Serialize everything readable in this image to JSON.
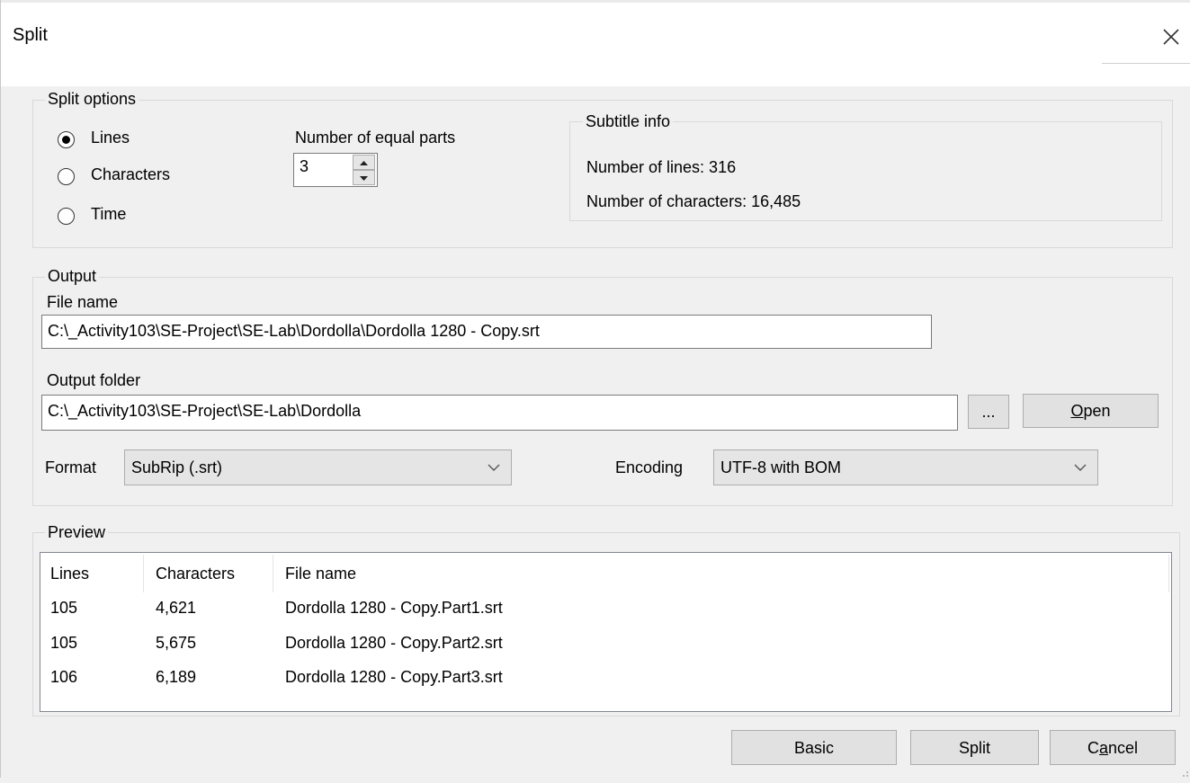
{
  "window": {
    "title": "Split",
    "close_icon": "close-icon"
  },
  "split_options": {
    "label": "Split options",
    "radios": [
      {
        "label": "Lines",
        "checked": true
      },
      {
        "label": "Characters",
        "checked": false
      },
      {
        "label": "Time",
        "checked": false
      }
    ],
    "parts_label": "Number of equal parts",
    "parts_value": "3"
  },
  "subtitle_info": {
    "label": "Subtitle info",
    "lines_text": "Number of lines: 316",
    "chars_text": "Number of characters: 16,485"
  },
  "output": {
    "label": "Output",
    "file_name_label": "File name",
    "file_name_value": "C:\\_Activity103\\SE-Project\\SE-Lab\\Dordolla\\Dordolla 1280 - Copy.srt",
    "folder_label": "Output folder",
    "folder_value": "C:\\_Activity103\\SE-Project\\SE-Lab\\Dordolla",
    "browse_label": "...",
    "open_label_access": "O",
    "open_label_rest": "pen",
    "format_label": "Format",
    "format_value": "SubRip (.srt)",
    "encoding_label": "Encoding",
    "encoding_value": "UTF-8 with BOM"
  },
  "preview": {
    "label": "Preview",
    "columns": [
      "Lines",
      "Characters",
      "File name"
    ],
    "rows": [
      [
        "105",
        "4,621",
        "Dordolla 1280 - Copy.Part1.srt"
      ],
      [
        "105",
        "5,675",
        "Dordolla 1280 - Copy.Part2.srt"
      ],
      [
        "106",
        "6,189",
        "Dordolla 1280 - Copy.Part3.srt"
      ]
    ]
  },
  "buttons": {
    "basic_label": "Basic",
    "split_label": "Split",
    "cancel_a": "C",
    "cancel_b": "a",
    "cancel_c": "ncel"
  }
}
